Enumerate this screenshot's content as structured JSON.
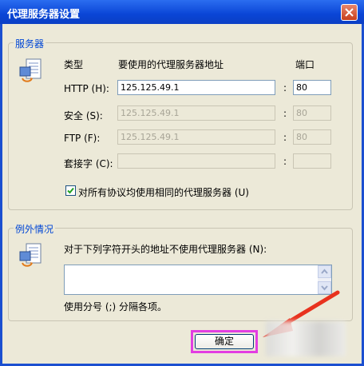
{
  "window": {
    "title": "代理服务器设置"
  },
  "servers": {
    "legend": "服务器",
    "col_type": "类型",
    "col_address": "要使用的代理服务器地址",
    "col_port": "端口",
    "colon": ":",
    "rows": [
      {
        "label": "HTTP (H):",
        "address": "125.125.49.1",
        "port": "80",
        "enabled": true
      },
      {
        "label": "安全 (S):",
        "address": "125.125.49.1",
        "port": "80",
        "enabled": false
      },
      {
        "label": "FTP (F):",
        "address": "125.125.49.1",
        "port": "80",
        "enabled": false
      },
      {
        "label": "套接字 (C):",
        "address": "",
        "port": "",
        "enabled": false
      }
    ],
    "same_proxy_label": "对所有协议均使用相同的代理服务器 (U)",
    "same_proxy_checked": true
  },
  "exceptions": {
    "legend": "例外情况",
    "description": "对于下列字符开头的地址不使用代理服务器 (N):",
    "value": "",
    "hint": "使用分号 (;) 分隔各项。"
  },
  "ok_button": {
    "label": "确定"
  },
  "colors": {
    "accent": "#0046d5",
    "highlight": "#e23ee2",
    "arrow": "#e8321e"
  }
}
